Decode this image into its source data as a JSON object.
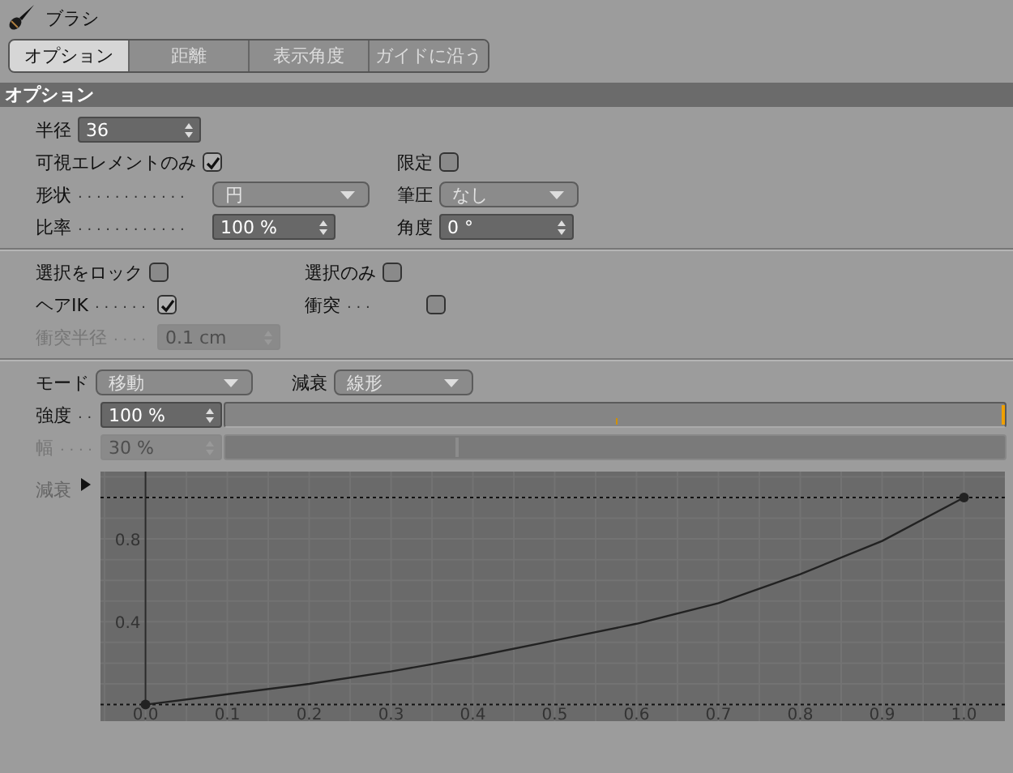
{
  "panel": {
    "title": "ブラシ"
  },
  "tabs": [
    {
      "label": "オプション",
      "selected": true
    },
    {
      "label": "距離",
      "selected": false
    },
    {
      "label": "表示角度",
      "selected": false
    },
    {
      "label": "ガイドに沿う",
      "selected": false
    }
  ],
  "section": {
    "title": "オプション"
  },
  "groups": [
    {
      "rows": [
        [
          {
            "label": "半径",
            "kind": "number",
            "value": "36",
            "disabled": false
          }
        ],
        [
          {
            "label": "可視エレメントのみ",
            "kind": "checkbox",
            "checked": true,
            "disabled": false
          },
          {
            "label": "限定",
            "kind": "checkbox",
            "checked": false,
            "disabled": false
          }
        ],
        [
          {
            "label": "形状",
            "leader": ". . . . . . . . . . . .",
            "kind": "dropdown",
            "value": "円",
            "disabled": false
          },
          {
            "label": "筆圧",
            "kind": "dropdown",
            "value": "なし",
            "disabled": false
          }
        ],
        [
          {
            "label": "比率",
            "leader": ". . . . . . . . . . . .",
            "kind": "number",
            "value": "100 %",
            "disabled": false
          },
          {
            "label": "角度",
            "kind": "number",
            "value": "0 °",
            "disabled": false
          }
        ]
      ]
    },
    {
      "rows": [
        [
          {
            "label": "選択をロック",
            "kind": "checkbox",
            "checked": false,
            "disabled": false
          },
          {
            "label": "選択のみ",
            "kind": "checkbox",
            "checked": false,
            "disabled": false
          }
        ],
        [
          {
            "label": "ヘアIK",
            "leader": ". . . . . .",
            "kind": "checkbox",
            "checked": true,
            "disabled": false
          },
          {
            "label": "衝突",
            "leader": ". . .",
            "kind": "checkbox",
            "checked": false,
            "disabled": false
          }
        ],
        [
          {
            "label": "衝突半径",
            "leader": ". . . .",
            "kind": "number",
            "value": "0.1 cm",
            "disabled": true
          }
        ]
      ]
    },
    {
      "rows": [
        [
          {
            "label": "モード",
            "kind": "dropdown",
            "value": "移動",
            "disabled": false
          },
          {
            "label": "減衰",
            "kind": "dropdown",
            "value": "線形",
            "disabled": false
          }
        ],
        [
          {
            "label": "強度",
            "leader": ". .",
            "kind": "slider",
            "value": "100 %",
            "level": 1,
            "disabled": false
          }
        ],
        [
          {
            "label": "幅",
            "leader": ". . . .",
            "kind": "slider",
            "value": "30 %",
            "level": 0.3,
            "disabled": true
          }
        ]
      ]
    }
  ],
  "falloff": {
    "label": "減衰",
    "chart_data": {
      "type": "line",
      "xlim": [
        -0.055,
        1.05
      ],
      "ylim": [
        -0.08,
        1.125
      ],
      "x": [
        0,
        0.1,
        0.2,
        0.3,
        0.4,
        0.5,
        0.6,
        0.7,
        0.8,
        0.9,
        1.0
      ],
      "grid": true,
      "ref_lines": [
        {
          "axis": "y",
          "value": 1,
          "color": "#111111"
        },
        {
          "axis": "y",
          "value": 0,
          "color": "#111111"
        }
      ],
      "series": [
        {
          "color": "#222222",
          "values": [
            0,
            0.05,
            0.1,
            0.16,
            0.23,
            0.31,
            0.39,
            0.49,
            0.63,
            0.79,
            1.0
          ]
        }
      ],
      "xticks": [
        {
          "value": 0,
          "label": "0.0"
        },
        0.1,
        0.2,
        0.3,
        0.4,
        0.5,
        0.6,
        0.7,
        0.8,
        0.9,
        {
          "value": 1,
          "label": "1.0"
        }
      ],
      "yticks": [
        0.4,
        0.8
      ]
    }
  }
}
